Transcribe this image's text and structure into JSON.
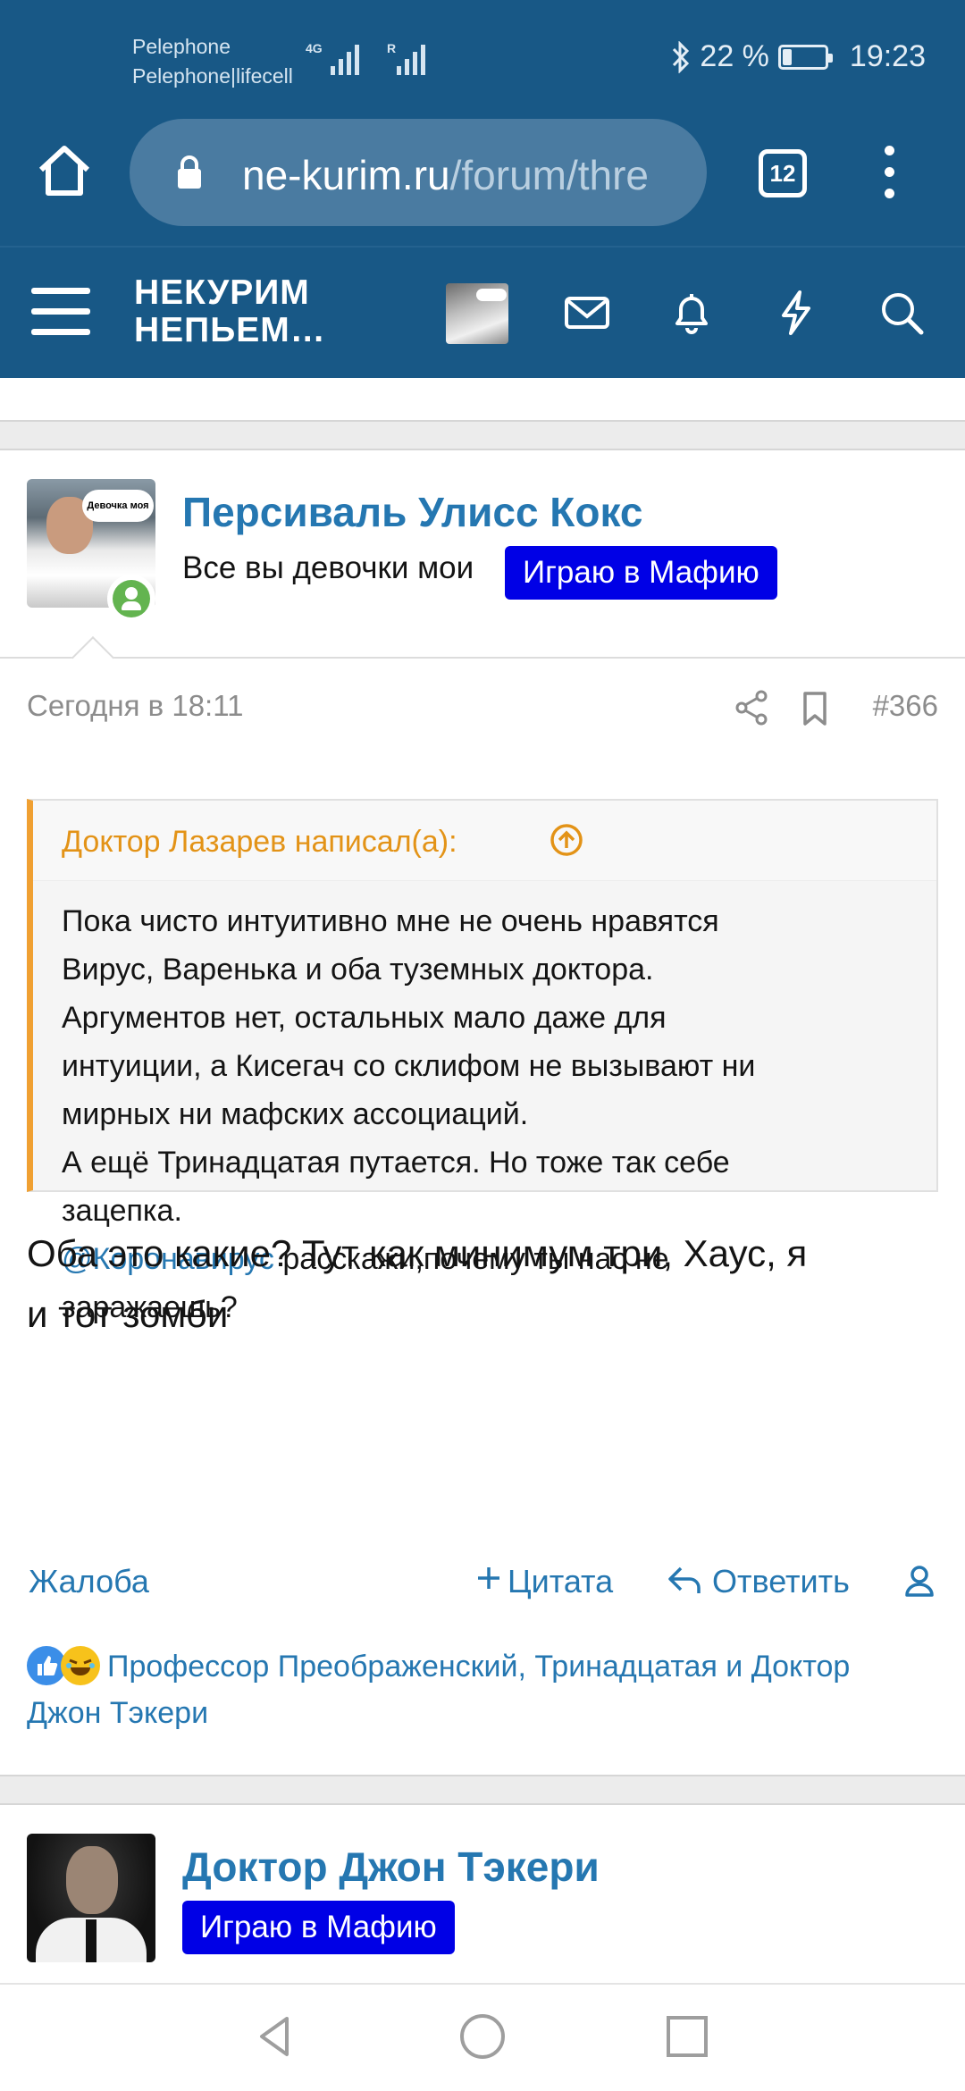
{
  "status_bar": {
    "carrier_line1": "Pelephone",
    "carrier_line2": "Pelephone|lifecell",
    "net1": "4G",
    "net2": "R",
    "battery_percent": "22 %",
    "battery_level": 0.22,
    "time": "19:23"
  },
  "browser": {
    "url_domain": "ne-kurim.ru",
    "url_path": "/forum/thre",
    "tab_count": "12"
  },
  "site": {
    "logo_line1": "НЕКУРИМ",
    "logo_line2": "НЕПЬЕМ…"
  },
  "posts": [
    {
      "username": "Персиваль Улисс Кокс",
      "user_title": "Все вы девочки мои",
      "banner": "Играю в Мафию",
      "avatar_caption": "Девочка моя",
      "date": "Сегодня в 18:11",
      "number": "#366",
      "quote": {
        "author": "Доктор Лазарев написал(а):",
        "lines": [
          "Пока чисто интуитивно мне не очень нравятся",
          "Вирус, Варенька и оба туземных доктора.",
          "Аргументов нет, остальных мало даже для",
          "интуиции, а Кисегач со склифом не вызывают ни",
          "мирных ни мафских ассоциаций.",
          "А ещё Тринадцатая путается. Но тоже так себе",
          "зацепка."
        ],
        "mention": "@Коронавирус",
        "mention_rest": " расскажи,почему ты нас не",
        "last_line": "заражаешь?"
      },
      "text_line1": "Оба это какие? Тут как минимум три, Хаус, я",
      "text_line2": "и тот зомби",
      "actions": {
        "report": "Жалоба",
        "quote": "Цитата",
        "reply": "Ответить"
      },
      "reactions_line1": "Профессор Преображенский, Тринадцатая и Доктор",
      "reactions_line2": "Джон Тэкери"
    },
    {
      "username": "Доктор Джон Тэкери",
      "banner": "Играю в Мафию"
    }
  ],
  "colors": {
    "header_blue": "#185886",
    "link_blue": "#2577b1",
    "quote_orange": "#f0a032",
    "banner_blue": "#0000e6",
    "online_green": "#63b450"
  },
  "icons": [
    "home-icon",
    "lock-icon",
    "tabs-icon",
    "more-vert-icon",
    "menu-icon",
    "mail-icon",
    "bell-icon",
    "bolt-icon",
    "search-icon",
    "share-icon",
    "bookmark-icon",
    "arrow-up-circle-icon",
    "plus-icon",
    "reply-icon",
    "user-icon",
    "like-icon",
    "laugh-icon",
    "back-icon",
    "home-circle-icon",
    "recents-icon"
  ]
}
